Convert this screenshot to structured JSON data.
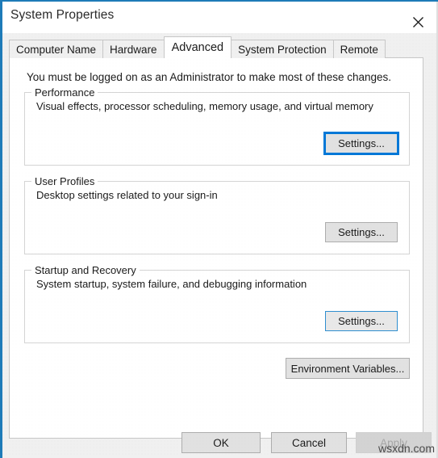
{
  "window": {
    "title": "System Properties",
    "close_icon": "close-icon",
    "accent_color": "#1e7bb8",
    "focus_color": "#0078d7"
  },
  "tabs": [
    {
      "label": "Computer Name",
      "selected": false
    },
    {
      "label": "Hardware",
      "selected": false
    },
    {
      "label": "Advanced",
      "selected": true
    },
    {
      "label": "System Protection",
      "selected": false
    },
    {
      "label": "Remote",
      "selected": false
    }
  ],
  "page": {
    "admin_note": "You must be logged on as an Administrator to make most of these changes.",
    "groups": [
      {
        "title": "Performance",
        "description": "Visual effects, processor scheduling, memory usage, and virtual memory",
        "button_label": "Settings...",
        "button_state": "focused"
      },
      {
        "title": "User Profiles",
        "description": "Desktop settings related to your sign-in",
        "button_label": "Settings...",
        "button_state": "normal"
      },
      {
        "title": "Startup and Recovery",
        "description": "System startup, system failure, and debugging information",
        "button_label": "Settings...",
        "button_state": "highlight"
      }
    ],
    "environment_variables_label": "Environment Variables..."
  },
  "footer": {
    "ok_label": "OK",
    "cancel_label": "Cancel",
    "apply_label": "Apply",
    "apply_disabled": true
  },
  "watermark": {
    "text": "wsxdn.com"
  }
}
